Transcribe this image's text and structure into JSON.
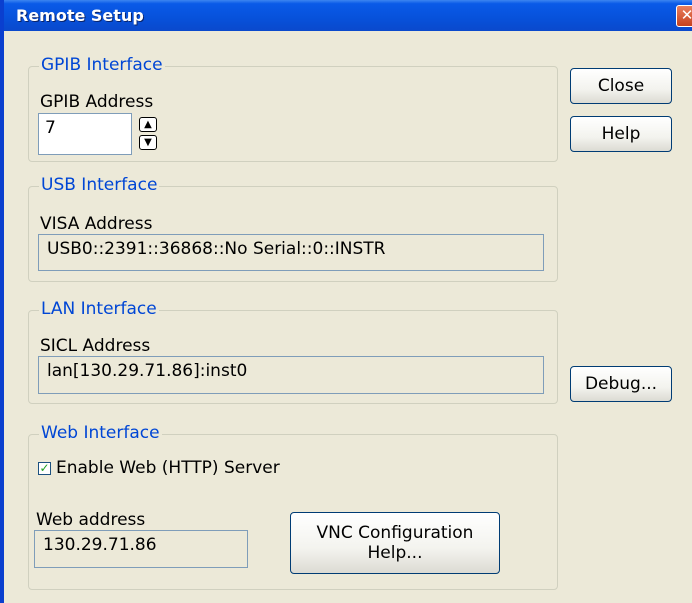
{
  "window": {
    "title": "Remote Setup",
    "close_glyph": "✕"
  },
  "gpib": {
    "legend": "GPIB Interface",
    "address_label": "GPIB Address",
    "address_value": "7",
    "spin_up": "▲",
    "spin_down": "▼"
  },
  "usb": {
    "legend": "USB Interface",
    "visa_label": "VISA Address",
    "visa_value": "USB0::2391::36868::No Serial::0::INSTR"
  },
  "lan": {
    "legend": "LAN Interface",
    "sicl_label": "SICL Address",
    "sicl_value": "lan[130.29.71.86]:inst0"
  },
  "web": {
    "legend": "Web Interface",
    "enable_label": "Enable Web (HTTP) Server",
    "enable_checked": true,
    "check_glyph": "✓",
    "address_label": "Web address",
    "address_value": "130.29.71.86",
    "vnc_button_line1": "VNC Configuration",
    "vnc_button_line2": "Help..."
  },
  "buttons": {
    "close": "Close",
    "help": "Help",
    "debug": "Debug..."
  }
}
